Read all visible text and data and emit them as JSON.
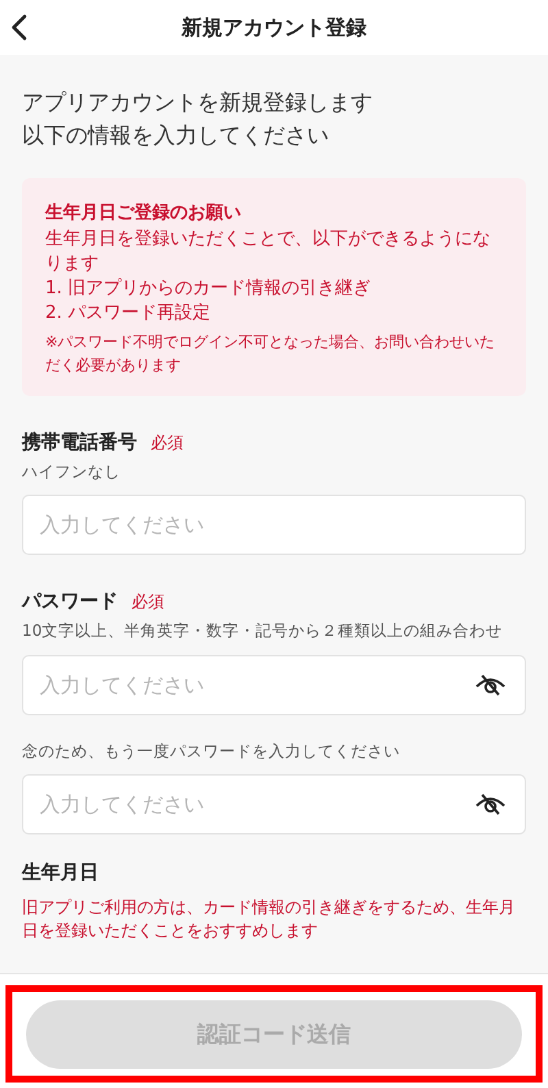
{
  "header": {
    "title": "新規アカウント登録"
  },
  "intro": [
    "アプリアカウントを新規登録します",
    "以下の情報を入力してください"
  ],
  "notice": {
    "title": "生年月日ご登録のお願い",
    "lines": [
      "生年月日を登録いただくことで、以下ができるようになります",
      "1. 旧アプリからのカード情報の引き継ぎ",
      "2. パスワード再設定"
    ],
    "note": "※パスワード不明でログイン不可となった場合、お問い合わせいただく必要があります"
  },
  "fields": [
    {
      "kind": "text",
      "label": "携帯電話番号",
      "required": "必須",
      "hint": "ハイフンなし",
      "placeholder": "入力してください"
    },
    {
      "kind": "password",
      "label": "パスワード",
      "required": "必須",
      "hint": "10文字以上、半角英字・数字・記号から２種類以上の組み合わせ",
      "placeholder": "入力してください"
    },
    {
      "kind": "password",
      "hint": "念のため、もう一度パスワードを入力してください",
      "placeholder": "入力してください"
    }
  ],
  "birthday": {
    "label": "生年月日",
    "note": "旧アプリご利用の方は、カード情報の引き継ぎをするため、生年月日を登録いただくことをおすすめします"
  },
  "footer": {
    "button": "認証コード送信",
    "disabled": true,
    "highlighted": true
  }
}
